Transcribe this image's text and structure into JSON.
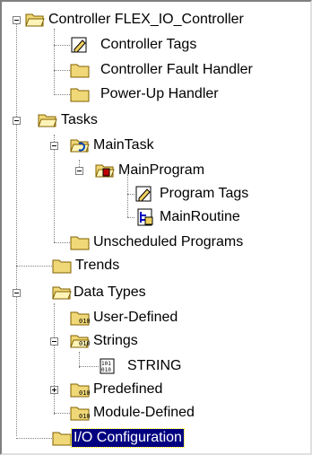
{
  "tree": {
    "controller": {
      "label": "Controller FLEX_IO_Controller",
      "children": {
        "tags": "Controller Tags",
        "fault_handler": "Controller Fault Handler",
        "powerup_handler": "Power-Up Handler"
      }
    },
    "tasks": {
      "label": "Tasks",
      "main_task": "MainTask",
      "main_program": "MainProgram",
      "program_tags": "Program Tags",
      "main_routine": "MainRoutine",
      "unscheduled": "Unscheduled Programs"
    },
    "trends": "Trends",
    "data_types": {
      "label": "Data Types",
      "user_defined": "User-Defined",
      "strings": "Strings",
      "string": "STRING",
      "predefined": "Predefined",
      "module_defined": "Module-Defined"
    },
    "io_config": "I/O Configuration"
  },
  "colors": {
    "folder": "#f0d878",
    "selection": "#000080"
  }
}
